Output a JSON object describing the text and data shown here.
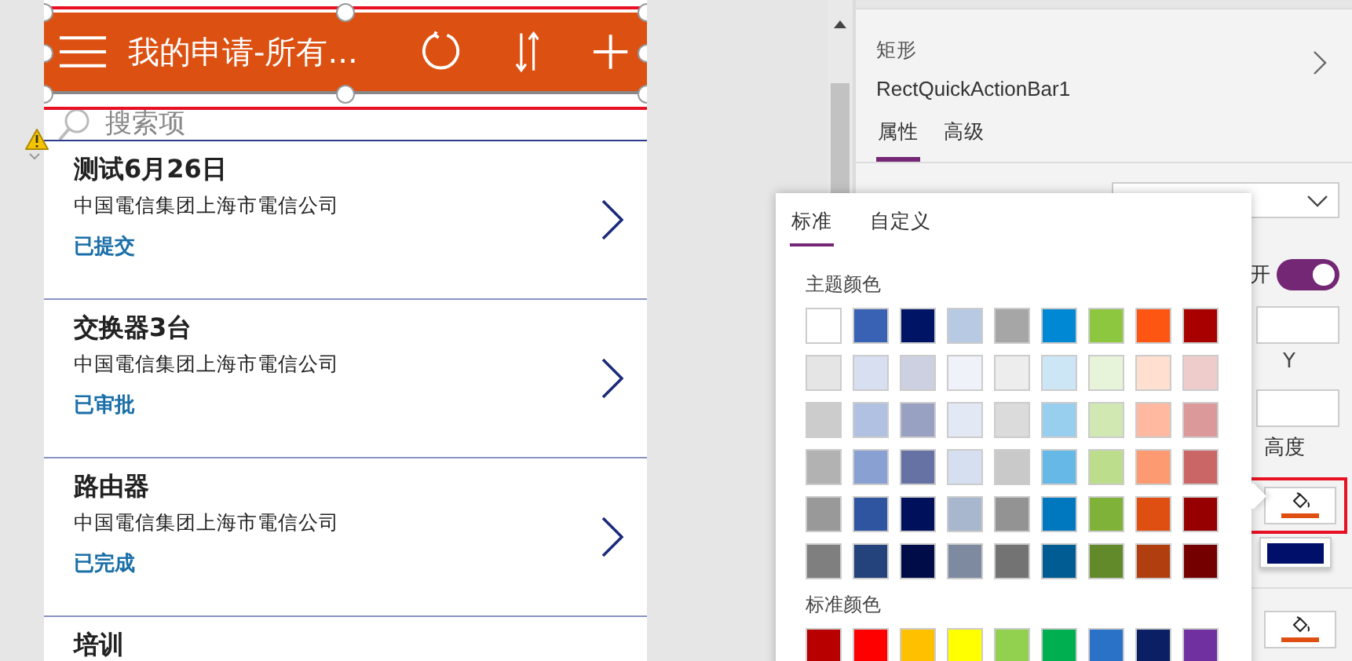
{
  "app": {
    "header": {
      "title": "我的申请-所有..."
    },
    "search": {
      "placeholder": "搜索项"
    },
    "items": [
      {
        "title": "测试6月26日",
        "company": "中国電信集团上海市電信公司",
        "status": "已提交"
      },
      {
        "title": "交换器3台",
        "company": "中国電信集团上海市電信公司",
        "status": "已审批"
      },
      {
        "title": "路由器",
        "company": "中国電信集团上海市電信公司",
        "status": "已完成"
      }
    ],
    "partial_item": {
      "title": "培训"
    }
  },
  "properties": {
    "control_type": "矩形",
    "control_name": "RectQuickActionBar1",
    "tabs": [
      {
        "label": "属性",
        "selected": true
      },
      {
        "label": "高级",
        "selected": false
      }
    ],
    "toggle": {
      "label": "开",
      "on": true
    },
    "y_label": "Y",
    "height_label": "高度",
    "color_buttons": [
      {
        "kind": "fill",
        "color": "#e04f12"
      },
      {
        "kind": "swatch",
        "color": "#000f6a"
      },
      {
        "kind": "fill",
        "color": "#e04f12"
      }
    ]
  },
  "color_picker": {
    "tabs": [
      {
        "label": "标准",
        "selected": true
      },
      {
        "label": "自定义",
        "selected": false
      }
    ],
    "theme_title": "主题颜色",
    "theme_colors": [
      [
        {
          "color": "#ffffff"
        },
        {
          "color": "#3a62b4"
        },
        {
          "color": "#001466"
        },
        {
          "color": "#b8c9e4"
        },
        {
          "color": "#a6a6a6"
        },
        {
          "color": "#0088d4"
        },
        {
          "color": "#8dc63f"
        },
        {
          "color": "#fc5612"
        },
        {
          "color": "#a80000"
        }
      ],
      [
        {
          "color": "#e5e5e5"
        },
        {
          "color": "#d8dff0"
        },
        {
          "color": "#cdd0e0"
        },
        {
          "color": "#eff3f9"
        },
        {
          "color": "#ededed"
        },
        {
          "color": "#cce6f5"
        },
        {
          "color": "#e8f4da"
        },
        {
          "color": "#fedfd0"
        },
        {
          "color": "#eecccc"
        }
      ],
      [
        {
          "color": "#cccccc"
        },
        {
          "color": "#b0c1e1"
        },
        {
          "color": "#99a1c2"
        },
        {
          "color": "#e3e9f4"
        },
        {
          "color": "#dbdbdb"
        },
        {
          "color": "#99cfee"
        },
        {
          "color": "#d1e8b2"
        },
        {
          "color": "#feb9a0"
        },
        {
          "color": "#dc9999"
        }
      ],
      [
        {
          "color": "#b2b2b2"
        },
        {
          "color": "#89a0d2"
        },
        {
          "color": "#6672a3"
        },
        {
          "color": "#d5dfef"
        },
        {
          "color": "#c9c9c9"
        },
        {
          "color": "#66b8e6"
        },
        {
          "color": "#bbdd8c"
        },
        {
          "color": "#fd9a71"
        },
        {
          "color": "#cb6666"
        }
      ],
      [
        {
          "color": "#999999"
        },
        {
          "color": "#2f54a0"
        },
        {
          "color": "#00105b"
        },
        {
          "color": "#a8b7ce"
        },
        {
          "color": "#939393"
        },
        {
          "color": "#0078bf"
        },
        {
          "color": "#7fb238"
        },
        {
          "color": "#e04f12"
        },
        {
          "color": "#970000"
        }
      ],
      [
        {
          "color": "#7f7f7f"
        },
        {
          "color": "#24427b"
        },
        {
          "color": "#000c47"
        },
        {
          "color": "#7e8aa0"
        },
        {
          "color": "#737373"
        },
        {
          "color": "#005c93"
        },
        {
          "color": "#628a2b"
        },
        {
          "color": "#b03e0e"
        },
        {
          "color": "#750000"
        }
      ]
    ],
    "standard_title": "标准颜色",
    "standard_colors": [
      {
        "color": "#b80000"
      },
      {
        "color": "#ff0000"
      },
      {
        "color": "#ffc000"
      },
      {
        "color": "#ffff00"
      },
      {
        "color": "#92d050"
      },
      {
        "color": "#00b050"
      },
      {
        "color": "#2a72c8"
      },
      {
        "color": "#0b1f65"
      },
      {
        "color": "#7030a0"
      }
    ]
  }
}
